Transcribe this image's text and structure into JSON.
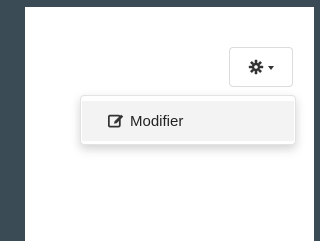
{
  "toolbar": {
    "gear_icon": "gear-icon",
    "caret_icon": "caret-down-icon"
  },
  "menu": {
    "items": [
      {
        "label": "Modifier",
        "icon": "edit-icon"
      }
    ]
  },
  "colors": {
    "background_dark": "#3b4b55",
    "panel": "#ffffff",
    "menu_hover": "#f3f3f3",
    "text": "#222222"
  }
}
